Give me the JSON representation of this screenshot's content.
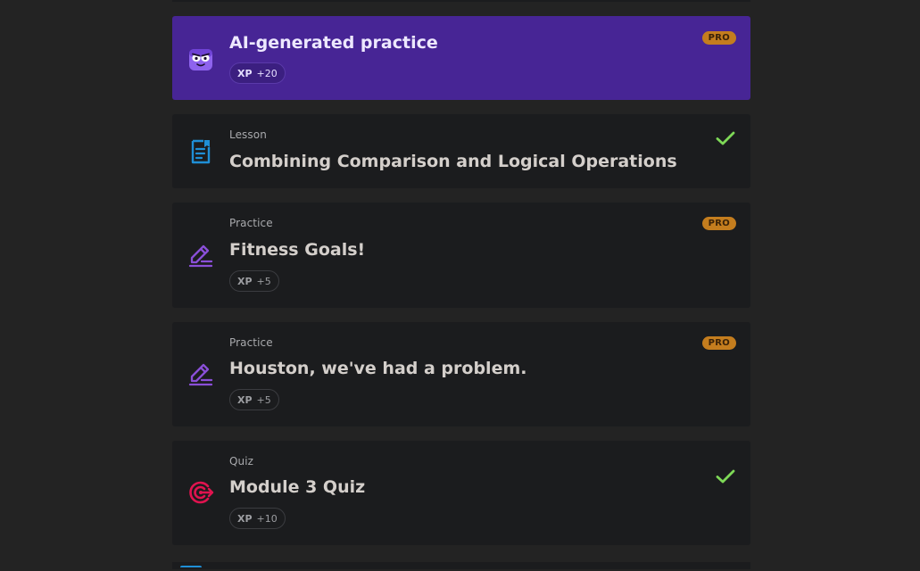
{
  "items": [
    {
      "type_label": "",
      "title": "AI-generated practice",
      "xp_key": "XP",
      "xp_value": "+20",
      "badge": "PRO",
      "icon": "ai-robot-icon",
      "accent": "#472595"
    },
    {
      "type_label": "Lesson",
      "title": "Combining Comparison and Logical Operations",
      "completed": true,
      "icon": "lesson-document-icon"
    },
    {
      "type_label": "Practice",
      "title": "Fitness Goals!",
      "xp_key": "XP",
      "xp_value": "+5",
      "badge": "PRO",
      "icon": "practice-pencil-icon"
    },
    {
      "type_label": "Practice",
      "title": "Houston, we've had a problem.",
      "xp_key": "XP",
      "xp_value": "+5",
      "badge": "PRO",
      "icon": "practice-pencil-icon"
    },
    {
      "type_label": "Quiz",
      "title": "Module 3 Quiz",
      "xp_key": "XP",
      "xp_value": "+10",
      "completed": true,
      "icon": "quiz-target-icon"
    }
  ],
  "colors": {
    "page_bg": "#232323",
    "card_bg": "#1b1c1e",
    "ai_card_bg": "#472595",
    "pro_badge": "#c47d1e",
    "check": "#7ed957",
    "lesson_icon": "#1f8fd6",
    "practice_icon": "#8a4fd8",
    "quiz_icon": "#e0134f"
  }
}
